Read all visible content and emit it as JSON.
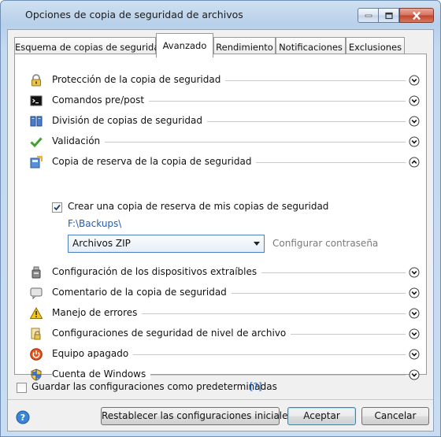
{
  "window": {
    "title": "Opciones de copia de seguridad de archivos"
  },
  "tabs": [
    {
      "label": "Esquema de copias de seguridad",
      "active": false
    },
    {
      "label": "Avanzado",
      "active": true
    },
    {
      "label": "Rendimiento",
      "active": false
    },
    {
      "label": "Notificaciones",
      "active": false
    },
    {
      "label": "Exclusiones",
      "active": false
    }
  ],
  "sections": [
    {
      "label": "Protección de la copia de seguridad",
      "icon": "lock-icon",
      "expanded": false
    },
    {
      "label": "Comandos pre/post",
      "icon": "terminal-icon",
      "expanded": false
    },
    {
      "label": "División de copias de seguridad",
      "icon": "split-icon",
      "expanded": false
    },
    {
      "label": "Validación",
      "icon": "checkmark-icon",
      "expanded": false
    },
    {
      "label": "Copia de reserva de la copia de seguridad",
      "icon": "reserve-copy-icon",
      "expanded": true
    },
    {
      "label": "Configuración de los dispositivos extraíbles",
      "icon": "usb-device-icon",
      "expanded": false
    },
    {
      "label": "Comentario de la copia de seguridad",
      "icon": "comment-icon",
      "expanded": false
    },
    {
      "label": "Manejo de errores",
      "icon": "warning-icon",
      "expanded": false
    },
    {
      "label": "Configuraciones de seguridad de nivel de archivo",
      "icon": "file-security-icon",
      "expanded": false
    },
    {
      "label": "Equipo apagado",
      "icon": "power-icon",
      "expanded": false
    },
    {
      "label": "Cuenta de Windows",
      "icon": "windows-shield-icon",
      "expanded": false
    }
  ],
  "reserve_copy": {
    "checkbox_label": "Crear una copia de reserva de mis copias de seguridad",
    "checked": true,
    "path": "F:\\Backups\\",
    "format_selected": "Archivos ZIP",
    "password_link": "Configurar contraseña"
  },
  "footer": {
    "save_default_label": "Guardar las configuraciones como predeterminadas",
    "save_default_checked": false,
    "help_link": "[?]",
    "reset_label": "Restablecer las configuraciones iniciales",
    "ok_label": "Aceptar",
    "cancel_label": "Cancelar"
  },
  "colors": {
    "link": "#1e5fb8",
    "accent": "#3c7fb1",
    "title_bar": "#b8d0ea"
  }
}
